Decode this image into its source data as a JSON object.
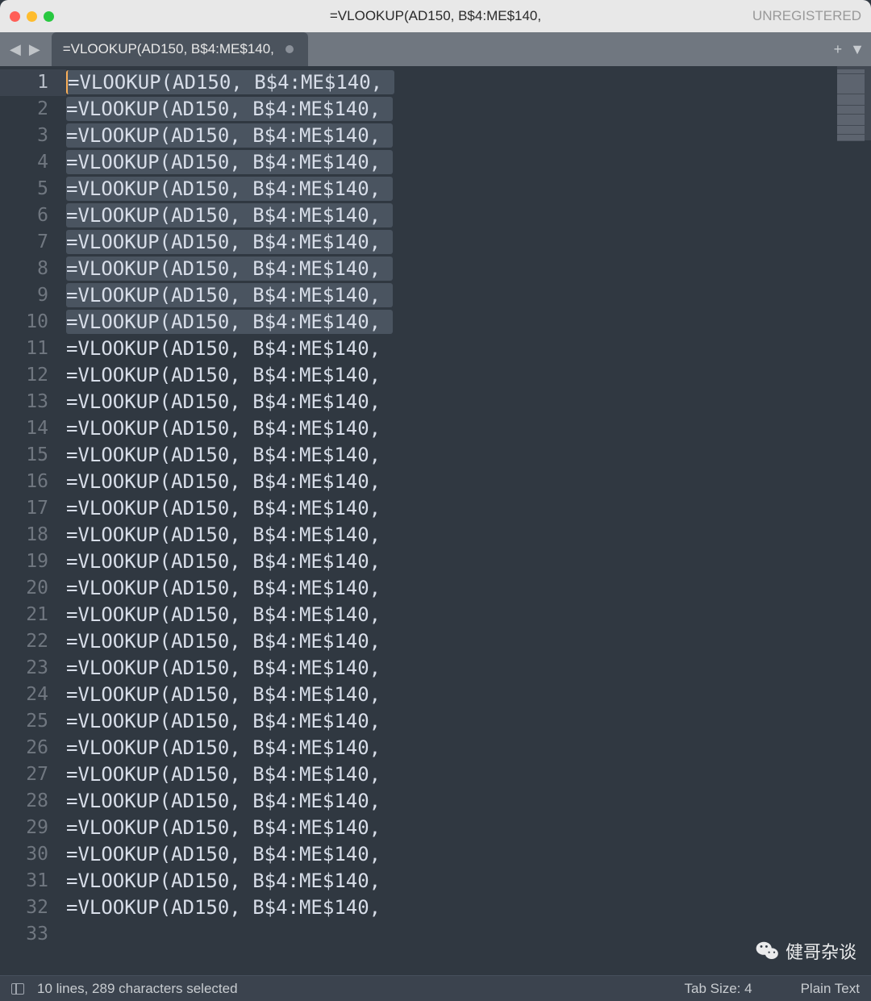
{
  "titlebar": {
    "title": "=VLOOKUP(AD150, B$4:ME$140,",
    "status": "UNREGISTERED"
  },
  "tab": {
    "label": "=VLOOKUP(AD150, B$4:ME$140,"
  },
  "editor": {
    "line_content": "=VLOOKUP(AD150, B$4:ME$140,",
    "total_lines": 33,
    "content_lines": 32,
    "selected_lines": 10,
    "active_line": 1
  },
  "statusbar": {
    "selection": "10 lines, 289 characters selected",
    "tab_size": "Tab Size: 4",
    "syntax": "Plain Text"
  },
  "watermark": {
    "text": "健哥杂谈"
  }
}
